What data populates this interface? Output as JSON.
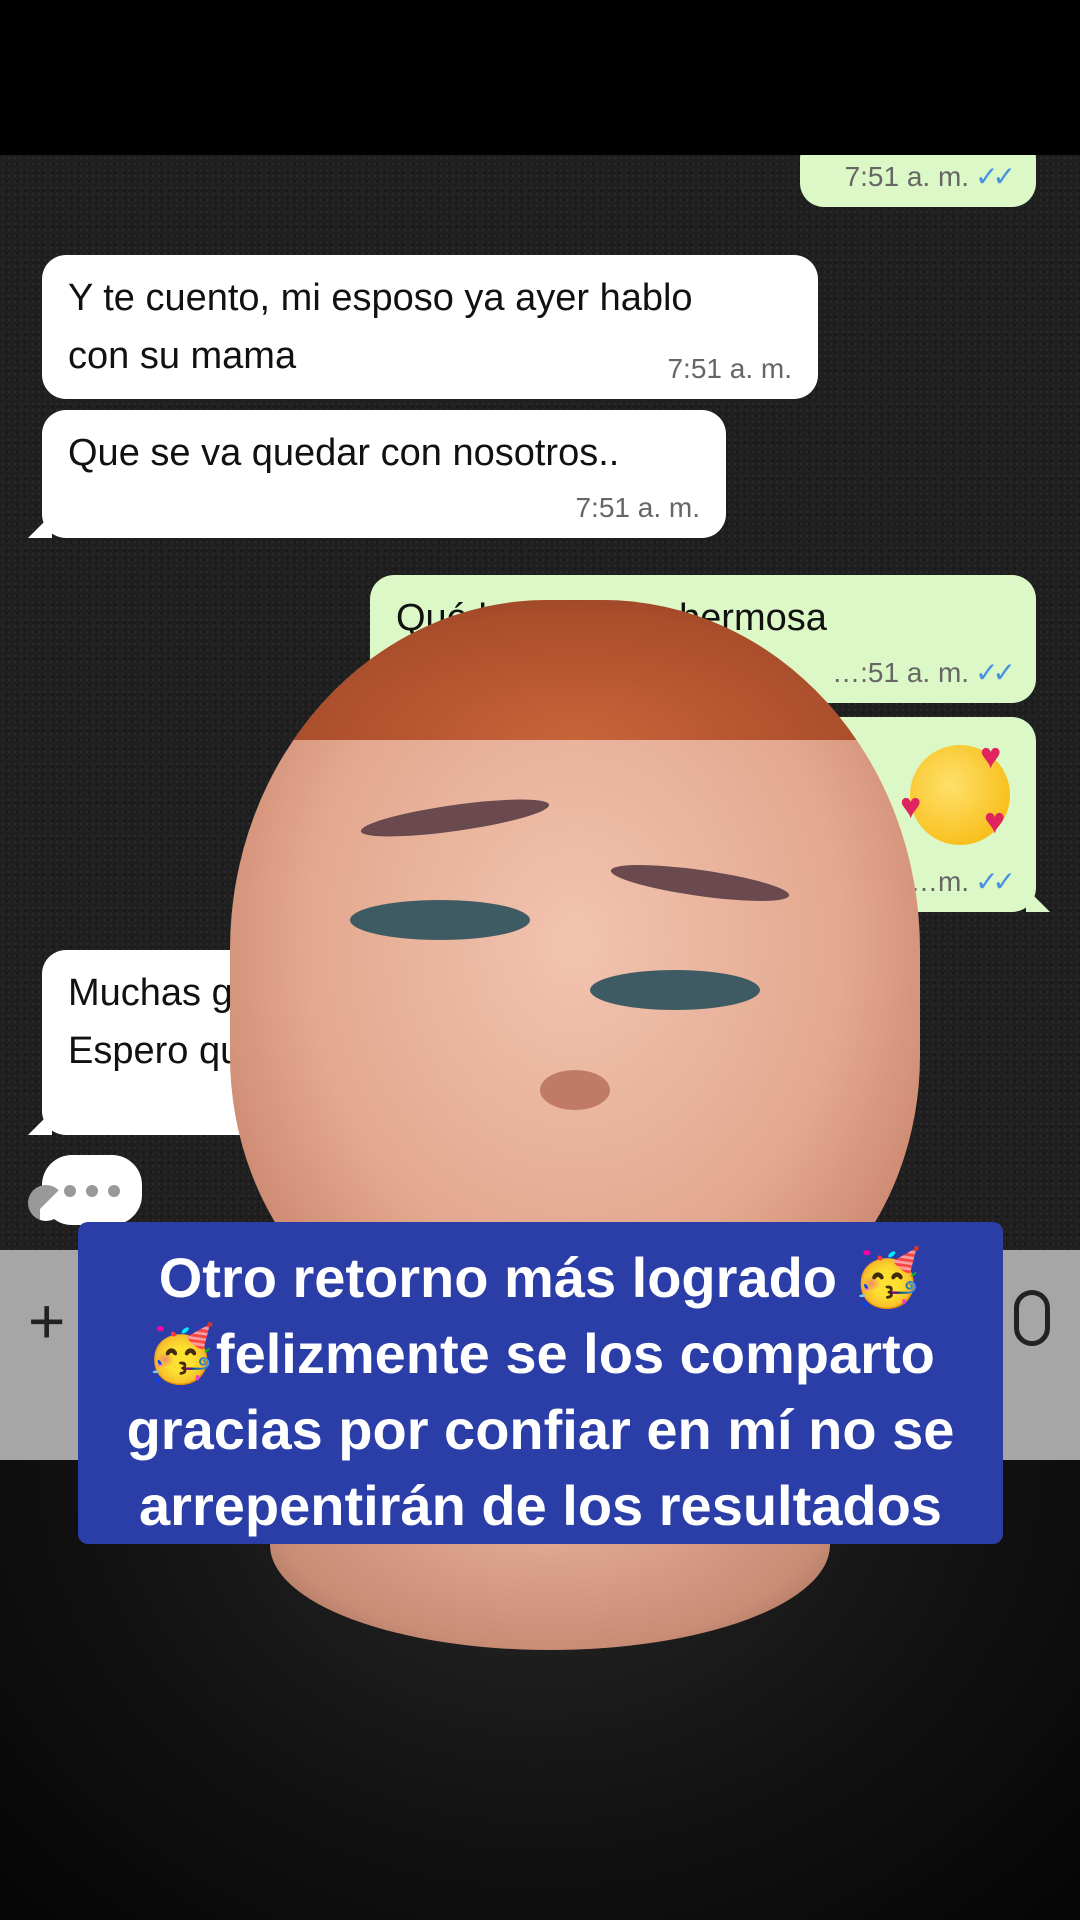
{
  "chat": {
    "messages": [
      {
        "direction": "out",
        "text": "",
        "time": "7:51 a. m.",
        "read": true
      },
      {
        "direction": "in",
        "text": "Y te cuento, mi esposo ya ayer hablo\ncon su mama",
        "time": "7:51 a. m."
      },
      {
        "direction": "in",
        "text": "Que se va quedar con nosotros..",
        "time": "7:51 a. m."
      },
      {
        "direction": "out",
        "text": "Qué h… …ades hermosa",
        "time": "…:51 a. m.",
        "read": true
      },
      {
        "direction": "out",
        "text": "",
        "emoji": "smiling-face-with-hearts",
        "time": "…m.",
        "read": true
      },
      {
        "direction": "in",
        "text": "Muchas gra…\nEspero que…",
        "time": ""
      }
    ],
    "typing_indicator": "•••"
  },
  "input_bar": {
    "plus_icon": "plus-icon",
    "mic_icon": "microphone-icon"
  },
  "caption": {
    "text": "Otro retorno más logrado 🥳\n🥳felizmente se los comparto gracias por confiar en mí no se arrepentirán de los resultados"
  },
  "colors": {
    "incoming_bubble": "#ffffff",
    "outgoing_bubble": "#dcf8c6",
    "caption_bg": "#2b3ea8",
    "read_ticks": "#4a90e2"
  }
}
